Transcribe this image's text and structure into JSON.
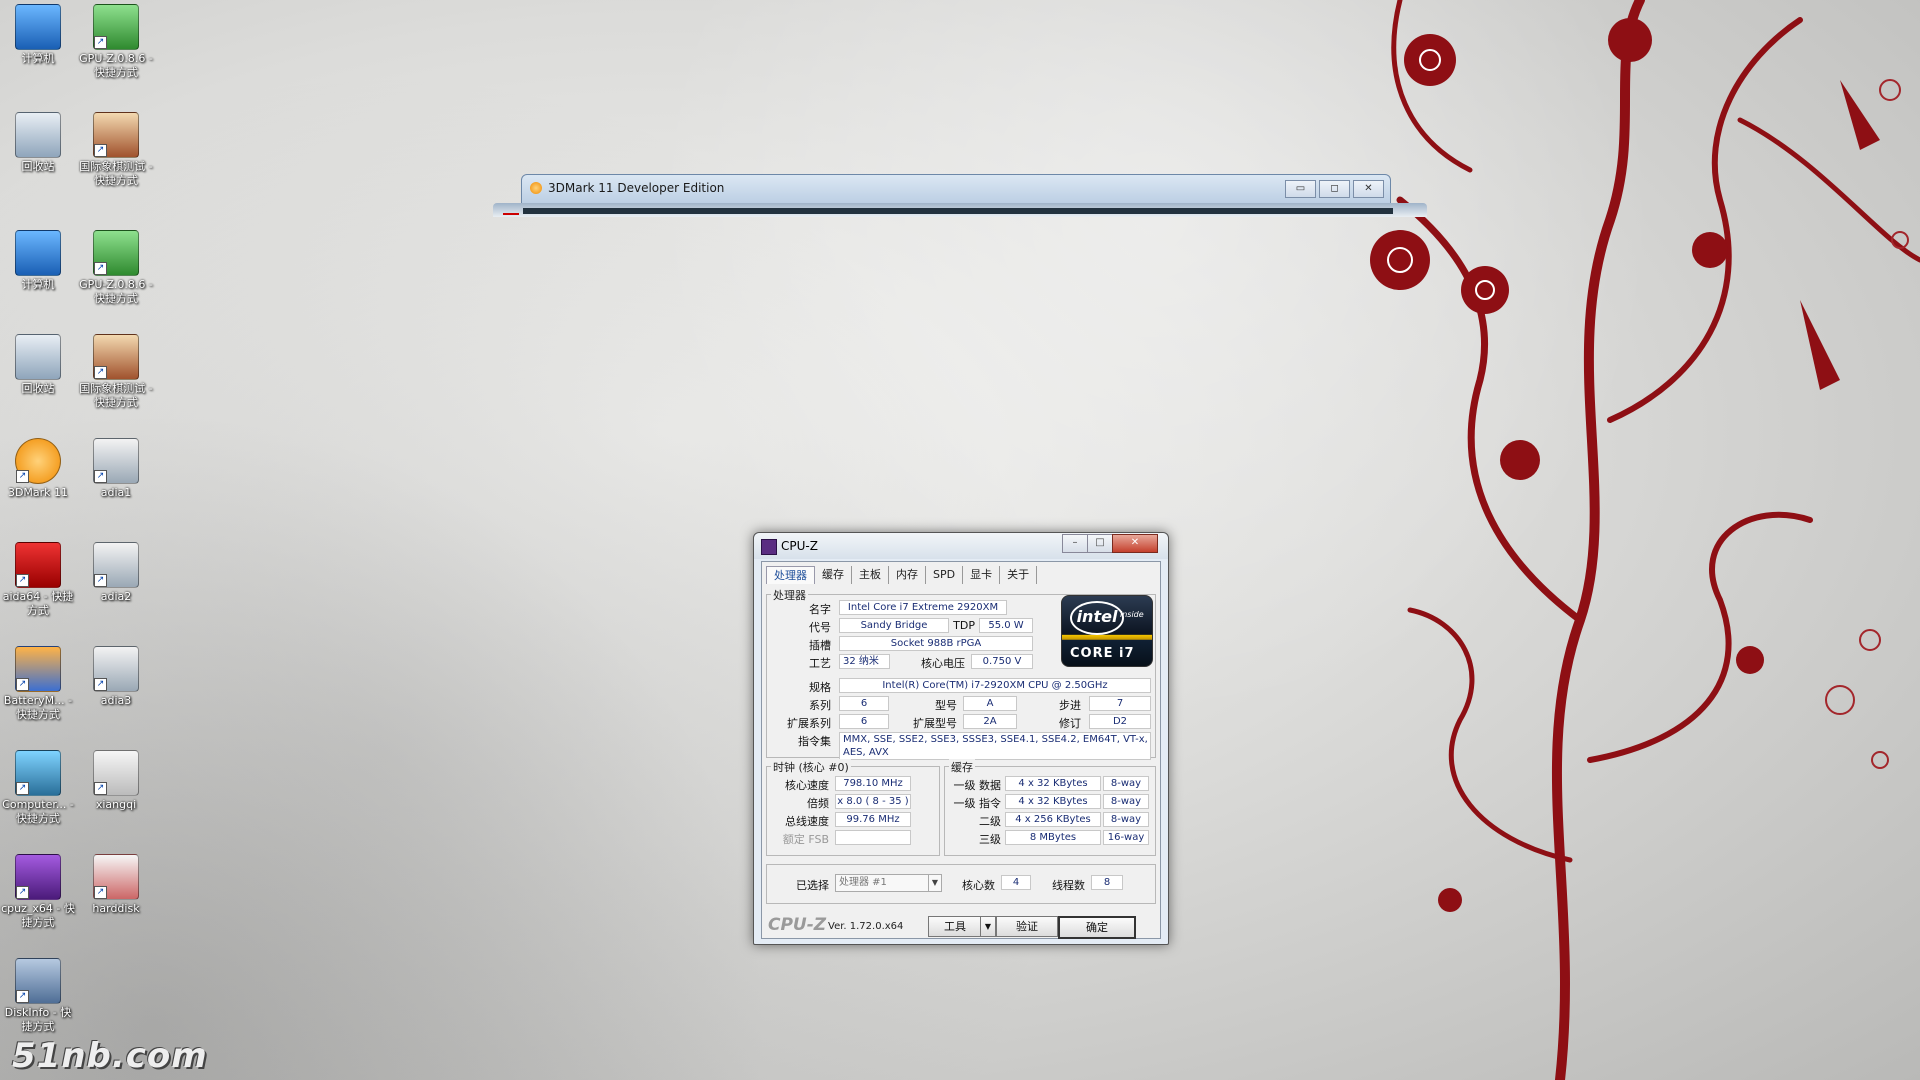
{
  "desktop": {
    "icons": [
      {
        "label": "计算机",
        "icon": "computer-icon"
      },
      {
        "label": "GPU-Z.0.8.6 - 快捷方式",
        "icon": "gpuz-icon"
      },
      {
        "label": "回收站",
        "icon": "recycle-bin-icon"
      },
      {
        "label": "国际象棋测试 - 快捷方式",
        "icon": "chess-icon"
      },
      {
        "label": "计算机",
        "icon": "computer-icon"
      },
      {
        "label": "GPU-Z.0.8.6 - 快捷方式",
        "icon": "gpuz-icon"
      },
      {
        "label": "回收站",
        "icon": "recycle-bin-icon"
      },
      {
        "label": "国际象棋测试 - 快捷方式",
        "icon": "chess-icon"
      },
      {
        "label": "3DMark 11",
        "icon": "3dmark-icon"
      },
      {
        "label": "adia1",
        "icon": "adia-icon"
      },
      {
        "label": "aida64 - 快捷方式",
        "icon": "aida64-icon"
      },
      {
        "label": "adia2",
        "icon": "adia-icon"
      },
      {
        "label": "BatteryM... - 快捷方式",
        "icon": "battery-icon"
      },
      {
        "label": "adia3",
        "icon": "adia-icon"
      },
      {
        "label": "Computer... - 快捷方式",
        "icon": "computer-app-icon"
      },
      {
        "label": "xiangqi",
        "icon": "xiangqi-icon"
      },
      {
        "label": "cpuz_x64 - 快捷方式",
        "icon": "cpuz-icon"
      },
      {
        "label": "harddisk",
        "icon": "harddisk-icon"
      },
      {
        "label": "DiskInfo - 快捷方式",
        "icon": "diskinfo-icon"
      }
    ],
    "watermark": "51nb.com"
  },
  "window3dmark": {
    "title": "3DMark 11 Developer Edition",
    "minimize": "▭",
    "maximize": "◻",
    "close": "✕"
  },
  "cpuz": {
    "title": "CPU-Z",
    "tabs": [
      "处理器",
      "缓存",
      "主板",
      "内存",
      "SPD",
      "显卡",
      "关于"
    ],
    "processor_group": "处理器",
    "labels": {
      "name": "名字",
      "codename": "代号",
      "tdp": "TDP",
      "socket": "插槽",
      "tech": "工艺",
      "voltage": "核心电压",
      "spec": "规格",
      "family": "系列",
      "model": "型号",
      "stepping": "步进",
      "ext_family": "扩展系列",
      "ext_model": "扩展型号",
      "revision": "修订",
      "instructions": "指令集"
    },
    "values": {
      "name": "Intel Core i7 Extreme 2920XM",
      "codename": "Sandy Bridge",
      "tdp": "55.0 W",
      "socket": "Socket 988B rPGA",
      "tech": "32 纳米",
      "voltage": "0.750 V",
      "spec": "Intel(R) Core(TM) i7-2920XM CPU @ 2.50GHz",
      "family": "6",
      "model": "A",
      "stepping": "7",
      "ext_family": "6",
      "ext_model": "2A",
      "revision": "D2",
      "instructions": "MMX, SSE, SSE2, SSE3, SSSE3, SSE4.1, SSE4.2, EM64T, VT-x, AES, AVX"
    },
    "intel_logo": {
      "brand": "intel",
      "inside": "inside",
      "line": "CORE i7"
    },
    "clocks": {
      "group": "时钟 (核心 #0)",
      "core_speed_label": "核心速度",
      "core_speed": "798.10 MHz",
      "multiplier_label": "倍频",
      "multiplier": "x 8.0 ( 8 - 35 )",
      "bus_speed_label": "总线速度",
      "bus_speed": "99.76 MHz",
      "rated_fsb_label": "额定 FSB",
      "rated_fsb": ""
    },
    "cache": {
      "group": "缓存",
      "rows": [
        {
          "label": "一级 数据",
          "size": "4 x 32 KBytes",
          "way": "8-way"
        },
        {
          "label": "一级 指令",
          "size": "4 x 32 KBytes",
          "way": "8-way"
        },
        {
          "label": "二级",
          "size": "4 x 256 KBytes",
          "way": "8-way"
        },
        {
          "label": "三级",
          "size": "8 MBytes",
          "way": "16-way"
        }
      ]
    },
    "selection": {
      "label": "已选择",
      "value": "处理器 #1",
      "cores_label": "核心数",
      "cores": "4",
      "threads_label": "线程数",
      "threads": "8"
    },
    "footer": {
      "logo": "CPU-Z",
      "version": "Ver. 1.72.0.x64",
      "tools": "工具",
      "validate": "验证",
      "ok": "确定"
    }
  }
}
